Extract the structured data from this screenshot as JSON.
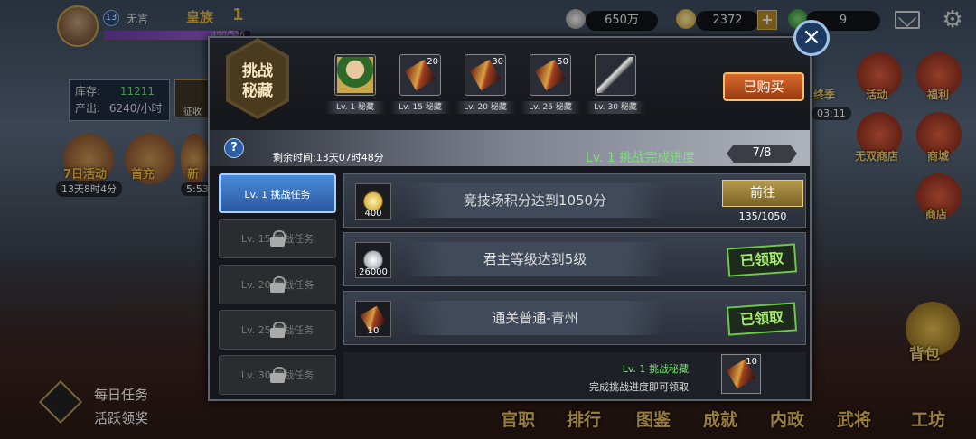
{
  "player": {
    "level": "13",
    "name": "无言",
    "title": "皇族",
    "vip": "1",
    "exp": "490/536",
    "exp_fraction": 0.914
  },
  "resources": {
    "silver": "650万",
    "gold": "2372",
    "jade": "9",
    "plus": "+"
  },
  "left_hud": {
    "stock_label": "库存:",
    "stock_value": "11211",
    "output_label": "产出:",
    "output_value": "6240/小时",
    "collect": "征收",
    "event1": "7日活动",
    "timer1": "13天8时4分",
    "event2": "首充",
    "event3": "新",
    "timer3": "5:53"
  },
  "daily": {
    "line1": "每日任务",
    "line2": "活跃领奖"
  },
  "bottom_menu": [
    "官职",
    "排行",
    "图鉴",
    "成就",
    "内政",
    "武将",
    "工坊"
  ],
  "right_hud": {
    "activity": "活动",
    "welfare": "福利",
    "wushuang": "无双商店",
    "shop": "商城",
    "store": "商店",
    "bag": "背包",
    "timer": "03:11",
    "partial": "终季"
  },
  "dialog": {
    "emblem_line1": "挑战",
    "emblem_line2": "秘藏",
    "rewards": [
      {
        "label": "Lv. 1 秘藏",
        "count": ""
      },
      {
        "label": "Lv. 15 秘藏",
        "count": "20"
      },
      {
        "label": "Lv. 20 秘藏",
        "count": "30"
      },
      {
        "label": "Lv. 25 秘藏",
        "count": "50"
      },
      {
        "label": "Lv. 30 秘藏",
        "count": ""
      }
    ],
    "bought": "已购买",
    "close": "×",
    "help": "?",
    "remaining": "剩余时间:13天07时48分",
    "progress_title": "Lv. 1 挑战完成进度",
    "progress_count": "7/8",
    "tabs": [
      "Lv. 1 挑战任务",
      "Lv. 15 挑战任务",
      "Lv. 20 挑战任务",
      "Lv. 25 挑战任务",
      "Lv. 30 挑战任务"
    ],
    "tasks": [
      {
        "reward": "400",
        "text": "竞技场积分达到1050分",
        "action": "前往",
        "progress": "135/1050"
      },
      {
        "reward": "26000",
        "text": "君主等级达到5级",
        "action": "已领取"
      },
      {
        "reward": "10",
        "text": "通关普通-青州",
        "action": "已领取"
      }
    ],
    "footer_title": "Lv. 1 挑战秘藏",
    "footer_desc": "完成挑战进度即可领取",
    "footer_count": "10"
  }
}
